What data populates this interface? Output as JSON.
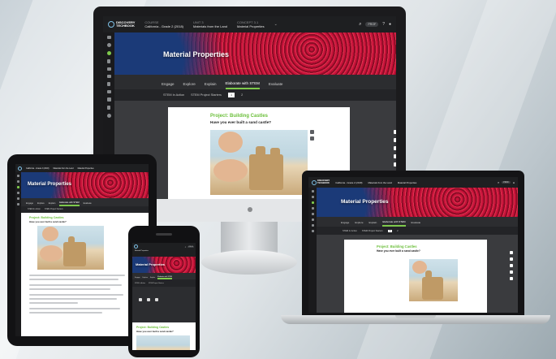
{
  "app": {
    "logo_text": "DISCOVERY\nTECHBOOK",
    "course_key": "COURSE",
    "course": "California - Grade 2 (2018)",
    "unit_key": "UNIT 3",
    "unit": "Materials from the Land",
    "concept_key": "CONCEPT 3.1",
    "concept": "Material Properties",
    "hero_title": "Material Properties",
    "search_icon": "search-icon",
    "user_pill": "PROF",
    "tabs": [
      "Engage",
      "Explore",
      "Explain",
      "Elaborate with STEM",
      "Evaluate"
    ],
    "active_tab_index": 3,
    "subtabs": [
      "STEM In Action",
      "STEM Project Starters",
      "1",
      "2"
    ],
    "project_title": "Project: Building Castles",
    "project_question": "Have you ever built a sand castle?"
  },
  "colors": {
    "accent_green": "#7ec94c",
    "topbar": "#1e1f21",
    "hero_red": "#c8123a"
  }
}
